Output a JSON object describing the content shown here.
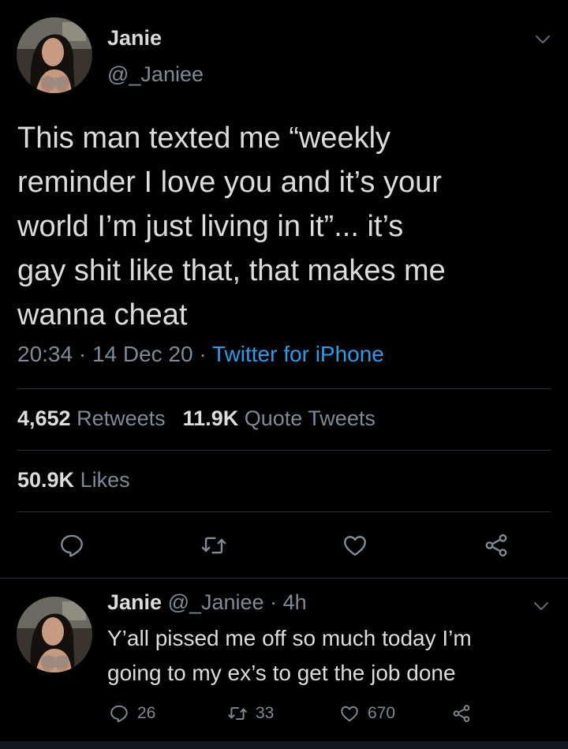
{
  "main_tweet": {
    "display_name": "Janie",
    "handle": "@_Janiee",
    "text_lines": [
      "This man texted me “weekly",
      "reminder I love you and it’s your",
      "world I’m just living in it”... it’s",
      "gay shit like that, that makes me",
      "wanna cheat"
    ],
    "time": "20:34",
    "date": "14 Dec 20",
    "source": "Twitter for iPhone",
    "retweets_count": "4,652",
    "retweets_label": "Retweets",
    "quote_count": "11.9K",
    "quote_label": "Quote Tweets",
    "likes_count": "50.9K",
    "likes_label": "Likes"
  },
  "reply_tweet": {
    "display_name": "Janie",
    "handle": "@_Janiee",
    "age": "4h",
    "text_lines": [
      "Y’all pissed me off so much today I’m",
      "going to my ex’s to get the job done"
    ],
    "reply_count": "26",
    "retweet_count": "33",
    "like_count": "670"
  },
  "colors": {
    "background": "#000000",
    "text_primary": "#dcdcdc",
    "text_secondary": "#7f8a95",
    "link": "#2d9ce8",
    "divider": "#2b2f34"
  },
  "icons": [
    "chevron-down-icon",
    "reply-icon",
    "retweet-icon",
    "like-icon",
    "share-icon"
  ]
}
